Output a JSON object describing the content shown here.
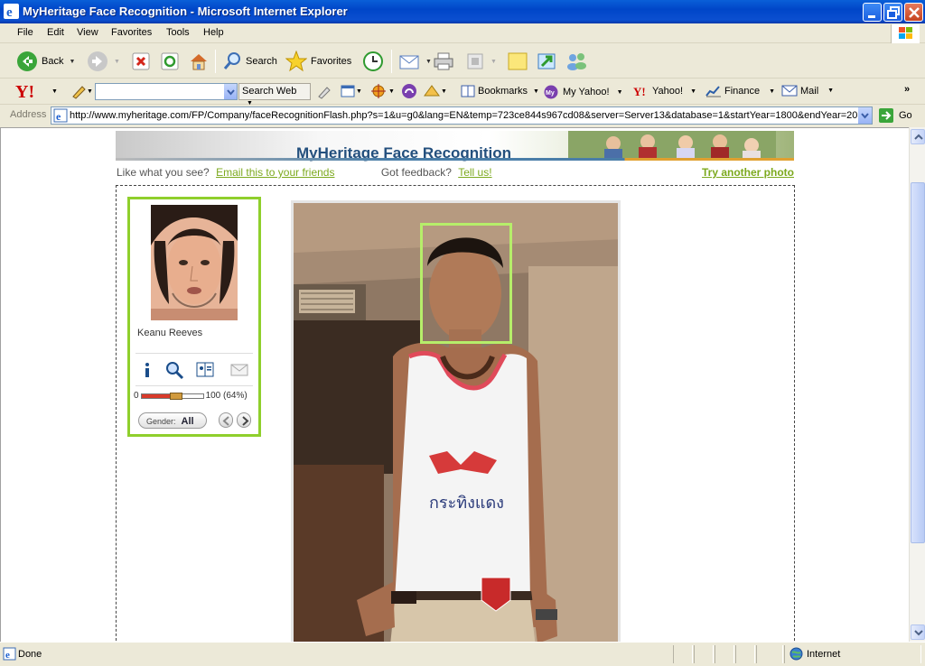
{
  "window": {
    "title": "MyHeritage Face Recognition - Microsoft Internet Explorer"
  },
  "menu": [
    "File",
    "Edit",
    "View",
    "Favorites",
    "Tools",
    "Help"
  ],
  "toolbar": {
    "back": "Back",
    "search": "Search",
    "favorites": "Favorites"
  },
  "yahoo_bar": {
    "search_button": "Search Web",
    "bookmarks": "Bookmarks",
    "my_yahoo": "My Yahoo!",
    "yahoo": "Yahoo!",
    "finance": "Finance",
    "mail": "Mail"
  },
  "address": {
    "label": "Address",
    "url": "http://www.myheritage.com/FP/Company/faceRecognitionFlash.php?s=1&u=g0&lang=EN&temp=723ce844s967cd08&server=Server13&database=1&startYear=1800&endYear=20",
    "go": "Go"
  },
  "page": {
    "banner_title": "MyHeritage Face Recognition",
    "like_text": "Like what you see?",
    "email_link": "Email this to your friends",
    "feedback_text": "Got feedback?",
    "tell_link": "Tell us!",
    "try_link": "Try another photo"
  },
  "match_card": {
    "name": "Keanu Reeves",
    "slider_min": "0",
    "slider_max": "100 (64%)",
    "match_percent": 64,
    "gender_label": "Gender:",
    "gender_value": "All",
    "icons": [
      "info-icon",
      "magnify-icon",
      "album-icon",
      "email-icon"
    ]
  },
  "status": {
    "left": "Done",
    "zone": "Internet"
  },
  "colors": {
    "accent_green": "#8fcf2c",
    "link_green": "#7ca91e",
    "face_box": "#b6ee6a",
    "title_blue": "#234f7d"
  }
}
